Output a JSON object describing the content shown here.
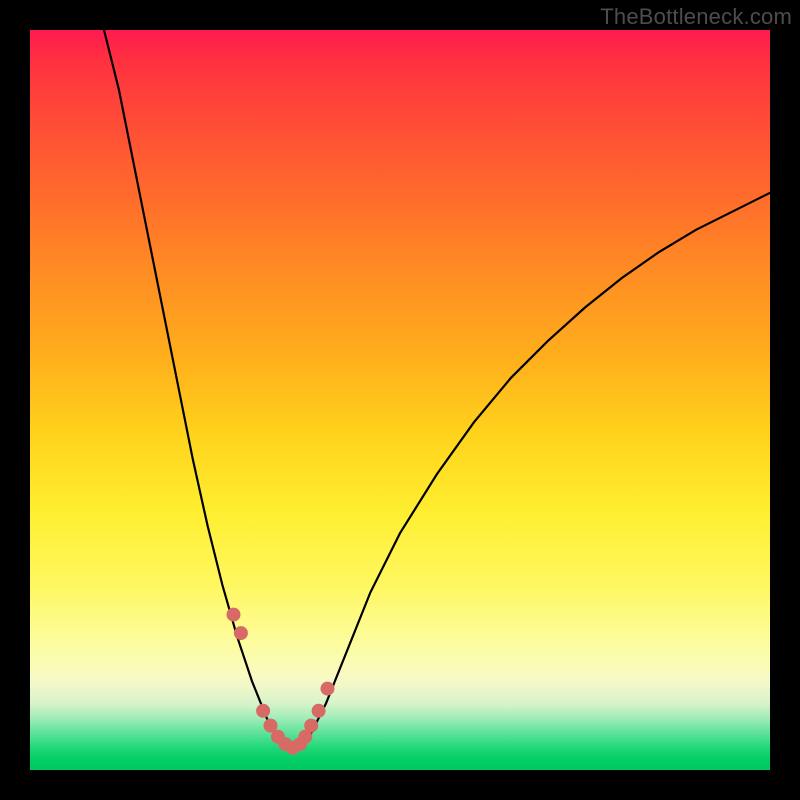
{
  "watermark": "TheBottleneck.com",
  "colors": {
    "frame": "#000000",
    "gradient_top": "#ff1a50",
    "gradient_bottom": "#00c85f",
    "curve": "#000000",
    "markers": "#d86a66"
  },
  "chart_data": {
    "type": "line",
    "title": "",
    "xlabel": "",
    "ylabel": "",
    "xlim": [
      0,
      100
    ],
    "ylim": [
      0,
      100
    ],
    "series": [
      {
        "name": "bottleneck-curve",
        "x": [
          10,
          12,
          14,
          16,
          18,
          20,
          22,
          24,
          26,
          28,
          30,
          32,
          33,
          34,
          35,
          36,
          37,
          38,
          40,
          42,
          44,
          46,
          50,
          55,
          60,
          65,
          70,
          75,
          80,
          85,
          90,
          95,
          100
        ],
        "values": [
          100,
          92,
          82,
          72,
          62,
          52,
          42,
          33,
          25,
          18,
          12,
          7,
          5,
          3.5,
          3,
          3,
          3.5,
          5,
          9,
          14,
          19,
          24,
          32,
          40,
          47,
          53,
          58,
          62.5,
          66.5,
          70,
          73,
          75.5,
          78
        ]
      }
    ],
    "markers": {
      "name": "highlight-dots",
      "x": [
        27.5,
        28.5,
        31.5,
        32.5,
        33.5,
        34.5,
        35.5,
        36.5,
        37.2,
        38.0,
        39.0,
        40.2
      ],
      "values": [
        21,
        18.5,
        8,
        6,
        4.5,
        3.5,
        3,
        3.5,
        4.5,
        6,
        8,
        11
      ]
    }
  }
}
